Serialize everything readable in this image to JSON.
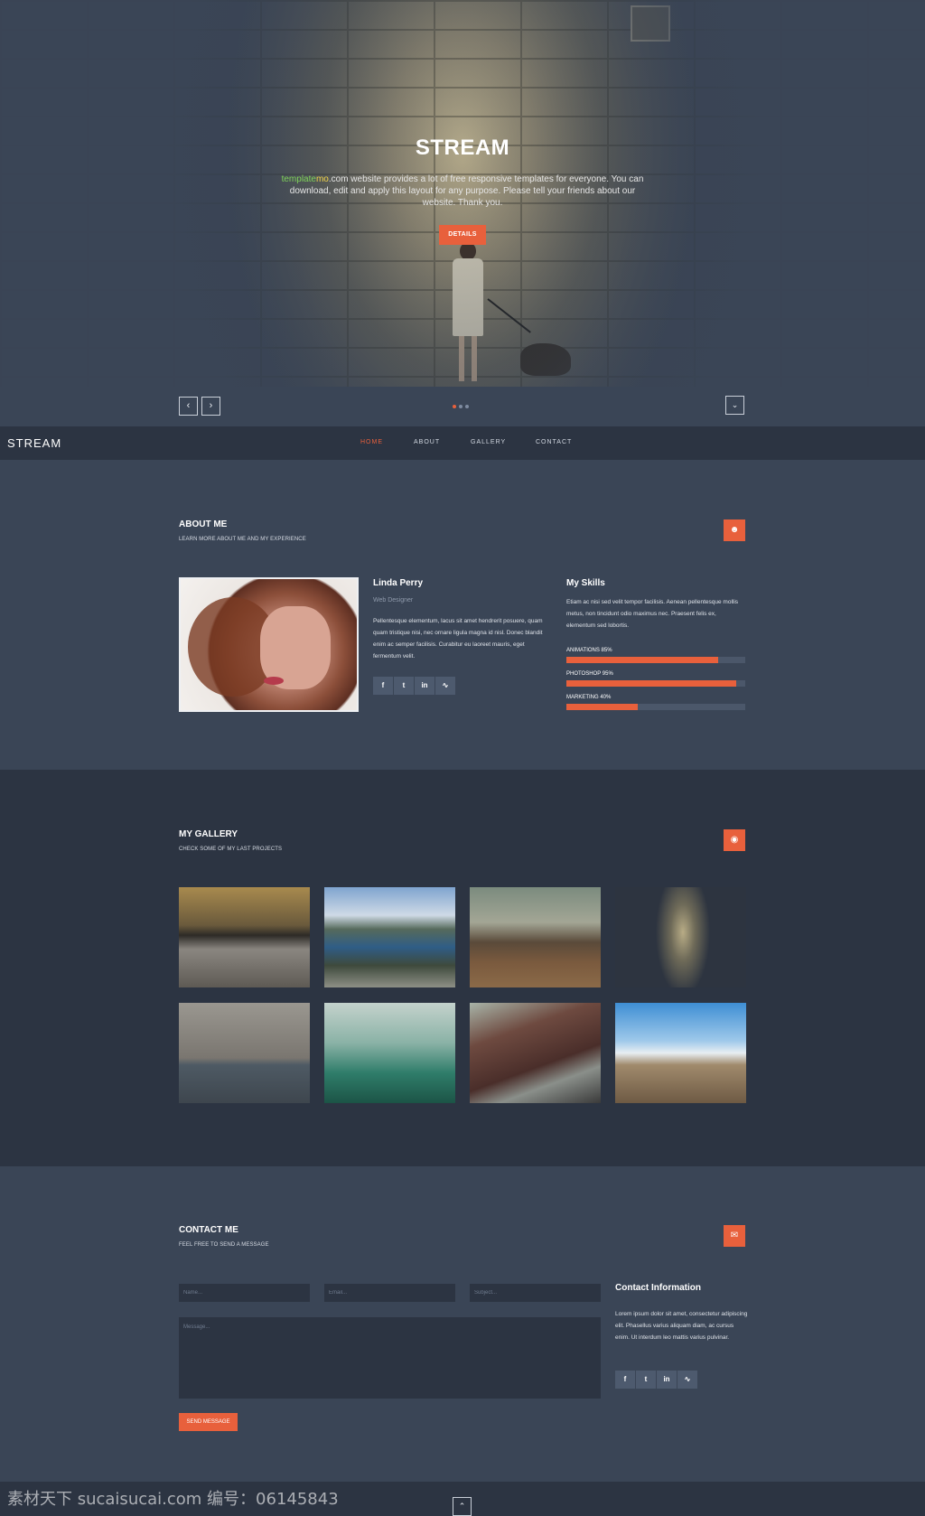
{
  "hero": {
    "title": "STREAM",
    "text_green": "template",
    "text_yellow": "mo",
    "text_rest": ".com website provides a lot of free responsive templates for everyone. You can download, edit and apply this layout for any purpose. Please tell your friends about our website. Thank you.",
    "button": "DETAILS"
  },
  "slider": {
    "prev_icon": "chevron-left",
    "next_icon": "chevron-right",
    "down_icon": "chevron-down",
    "dot_count": 3,
    "active_dot": 1
  },
  "nav": {
    "logo": "STREAM",
    "items": [
      "HOME",
      "ABOUT",
      "GALLERY",
      "CONTACT"
    ],
    "active": "HOME"
  },
  "about": {
    "title": "ABOUT ME",
    "subtitle": "LEARN MORE ABOUT ME AND MY EXPERIENCE",
    "icon": "user-icon",
    "name": "Linda Perry",
    "role": "Web Designer",
    "bio": "Pellentesque elementum, lacus sit amet hendrerit posuere, quam quam tristique nisi, nec ornare ligula magna id nisl. Donec blandit enim ac semper facilisis. Curabitur eu laoreet mauris, eget fermentum velit.",
    "social": [
      "f",
      "t",
      "in",
      "rss"
    ],
    "skills_title": "My Skills",
    "skills_text": "Etiam ac nisi sed velit tempor facilisis. Aenean pellentesque mollis metus, non tincidunt odio maximus nec. Praesent felis ex, elementum sed lobortis.",
    "skills": [
      {
        "label": "ANIMATIONS 85%",
        "value": 0.85
      },
      {
        "label": "PHOTOSHOP 95%",
        "value": 0.95
      },
      {
        "label": "MARKETING 40%",
        "value": 0.4
      }
    ]
  },
  "gallery": {
    "title": "MY GALLERY",
    "subtitle": "CHECK SOME OF MY LAST PROJECTS",
    "icon": "camera-icon",
    "images": [
      "rocky-beach",
      "fjord-mountains",
      "volcano-landscape",
      "woman-brick-wall",
      "wooden-room",
      "canoe-lake",
      "mountain-road",
      "wooden-pier"
    ]
  },
  "contact": {
    "title": "CONTACT ME",
    "subtitle": "FEEL FREE TO SEND A MESSAGE",
    "icon": "envelope-icon",
    "name_placeholder": "Name...",
    "email_placeholder": "Email...",
    "subject_placeholder": "Subject...",
    "message_placeholder": "Message...",
    "send_button": "SEND MESSAGE",
    "info_title": "Contact Information",
    "info_text": "Lorem ipsum dolor sit amet, consectetur adipiscing elit. Phasellus varius aliquam diam, ac cursus enim. Ut interdum leo mattis varius pulvinar.",
    "social": [
      "f",
      "t",
      "in",
      "rss"
    ]
  },
  "footer": {
    "up_icon": "chevron-up",
    "watermark": "素材天下 sucaisucai.com  编号：06145843"
  },
  "colors": {
    "accent": "#e8603c",
    "bg": "#3a4556",
    "bg_dark": "#2c3442"
  }
}
